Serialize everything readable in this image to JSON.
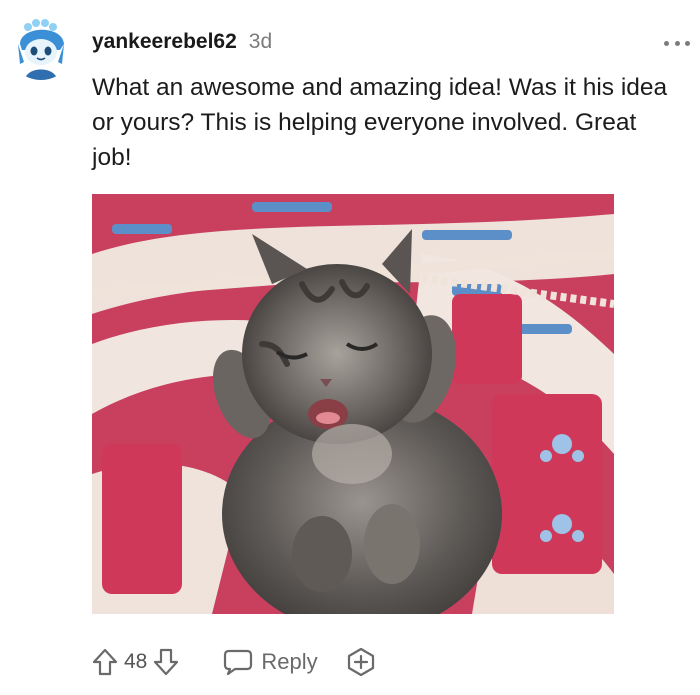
{
  "comment": {
    "username": "yankeerebel62",
    "time_ago": "3d",
    "body": "What an awesome and amazing idea! Was it his idea or yours? This is helping everyone involved. Great job!",
    "media": {
      "subject": "sleeping-kitten-gif"
    },
    "actions": {
      "score": "48",
      "reply_label": "Reply"
    }
  },
  "icons": {
    "upvote": "arrow-up-icon",
    "downvote": "arrow-down-icon",
    "reply": "speech-bubble-icon",
    "award": "award-plus-icon",
    "more": "ellipsis-icon"
  },
  "colors": {
    "text": "#1c1c1c",
    "muted": "#7c7c7c",
    "icon": "#6a6a6a"
  }
}
